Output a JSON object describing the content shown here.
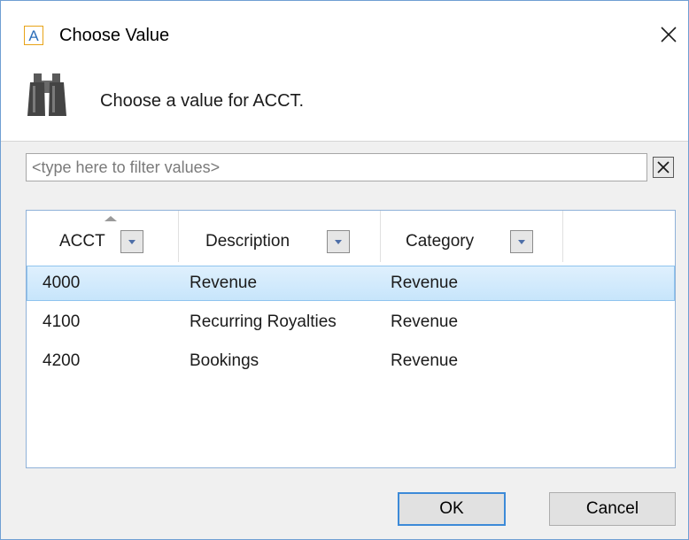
{
  "window": {
    "app_icon_letter": "A",
    "title": "Choose Value"
  },
  "header": {
    "icon": "binoculars-icon",
    "prompt": "Choose a value for ACCT."
  },
  "filter": {
    "placeholder": "<type here to filter values>",
    "value": ""
  },
  "grid": {
    "columns": [
      {
        "label": "ACCT",
        "sorted": "ascending"
      },
      {
        "label": "Description"
      },
      {
        "label": "Category"
      }
    ],
    "rows": [
      {
        "acct": "4000",
        "description": "Revenue",
        "category": "Revenue",
        "selected": true
      },
      {
        "acct": "4100",
        "description": "Recurring Royalties",
        "category": "Revenue",
        "selected": false
      },
      {
        "acct": "4200",
        "description": "Bookings",
        "category": "Revenue",
        "selected": false
      }
    ]
  },
  "buttons": {
    "ok": "OK",
    "cancel": "Cancel"
  },
  "colors": {
    "window_border": "#6f9fd3",
    "selection": "#c7e5fb",
    "default_button_border": "#3c8ad8"
  }
}
